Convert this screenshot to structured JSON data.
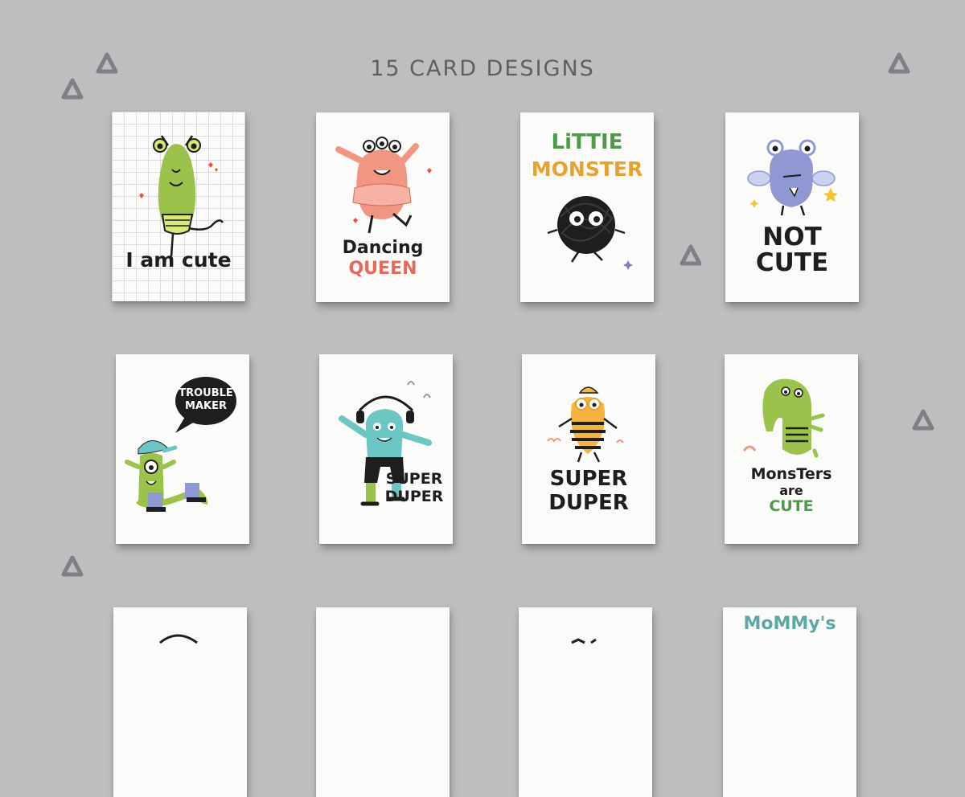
{
  "header": {
    "title": "15 CARD DESIGNS"
  },
  "cards": [
    {
      "text": "I am cute"
    },
    {
      "line1": "Dancing",
      "line2": "QUEEN"
    },
    {
      "line1": "LiTTIE",
      "line2": "MONSTER"
    },
    {
      "line1": "NOT",
      "line2": "CUTE"
    },
    {
      "line1": "TROUBLE",
      "line2": "MAKER"
    },
    {
      "line1": "SUPER",
      "line2": "DUPER"
    },
    {
      "line1": "SUPER",
      "line2": "DUPER"
    },
    {
      "line1": "MonsTers",
      "line2": "are",
      "line3": "CUTE"
    },
    {},
    {},
    {},
    {
      "text": "MoMMy's"
    }
  ],
  "colors": {
    "background": "#bdbec0",
    "green": "#9bc24a",
    "salmon": "#f09682",
    "blue": "#8f98d3",
    "teal": "#6cc6c4",
    "yellow": "#f4b53f",
    "black": "#1e1e1e"
  }
}
